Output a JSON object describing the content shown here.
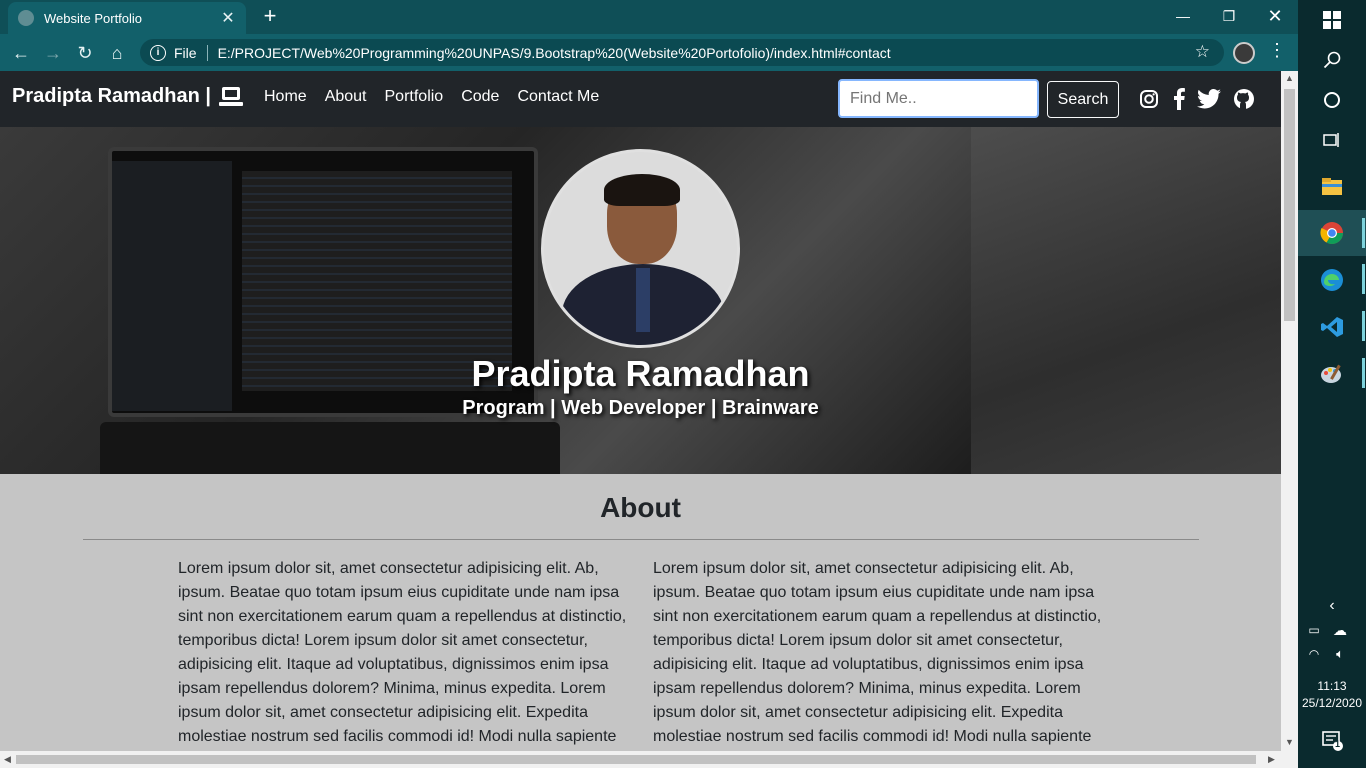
{
  "browser": {
    "tab_title": "Website Portfolio",
    "omni_scheme": "File",
    "url": "E:/PROJECT/Web%20Programming%20UNPAS/9.Bootstrap%20(Website%20Portofolio)/index.html#contact"
  },
  "site": {
    "brand": "Pradipta Ramadhan |",
    "menu": [
      "Home",
      "About",
      "Portfolio",
      "Code",
      "Contact Me"
    ],
    "search_placeholder": "Find Me..",
    "search_button": "Search",
    "social_icons": [
      "instagram-icon",
      "facebook-icon",
      "twitter-icon",
      "github-icon"
    ]
  },
  "hero": {
    "name": "Pradipta Ramadhan",
    "subtitle": "Program | Web Developer | Brainware"
  },
  "about": {
    "title": "About",
    "col1": "Lorem ipsum dolor sit, amet consectetur adipisicing elit. Ab, ipsum. Beatae quo totam ipsum eius cupiditate unde nam ipsa sint non exercitationem earum quam a repellendus at distinctio, temporibus dicta! Lorem ipsum dolor sit amet consectetur, adipisicing elit. Itaque ad voluptatibus, dignissimos enim ipsa ipsam repellendus dolorem? Minima, minus expedita. Lorem ipsum dolor sit, amet consectetur adipisicing elit. Expedita molestiae nostrum sed facilis commodi id! Modi nulla sapiente",
    "col2": "Lorem ipsum dolor sit, amet consectetur adipisicing elit. Ab, ipsum. Beatae quo totam ipsum eius cupiditate unde nam ipsa sint non exercitationem earum quam a repellendus at distinctio, temporibus dicta! Lorem ipsum dolor sit amet consectetur, adipisicing elit. Itaque ad voluptatibus, dignissimos enim ipsa ipsam repellendus dolorem? Minima, minus expedita. Lorem ipsum dolor sit, amet consectetur adipisicing elit. Expedita molestiae nostrum sed facilis commodi id! Modi nulla sapiente"
  },
  "taskbar": {
    "time": "11:13",
    "date": "25/12/2020",
    "notifications": "1"
  },
  "colors": {
    "chrome": "#12606a",
    "navbar": "#212529",
    "page_bg": "#c5c5c5"
  }
}
